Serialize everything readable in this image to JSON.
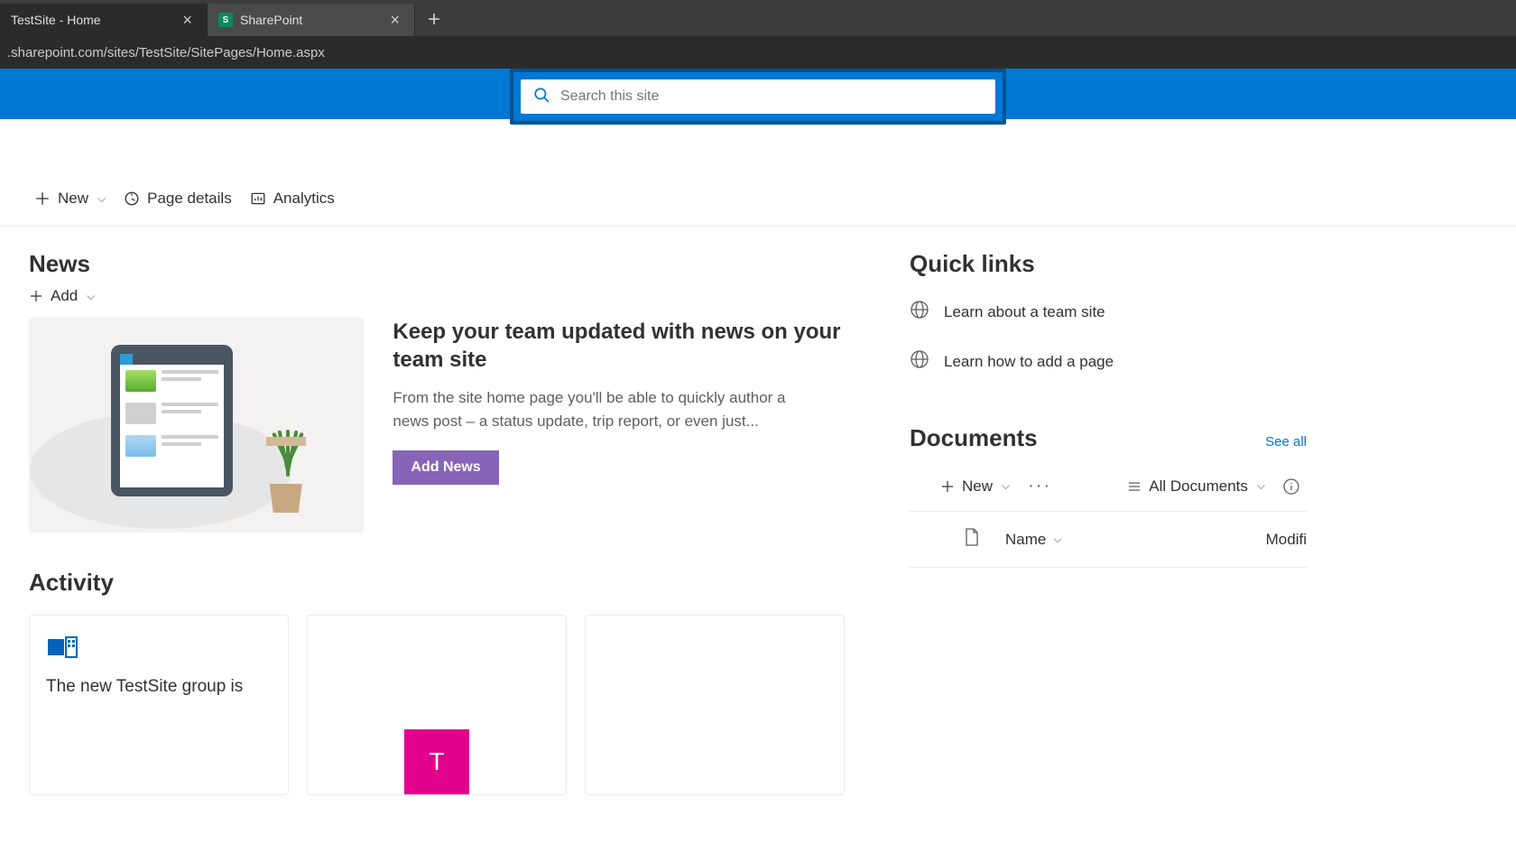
{
  "browser": {
    "tabs": [
      {
        "title": "TestSite - Home",
        "active": true
      },
      {
        "title": "SharePoint",
        "active": false,
        "favicon_letter": "S"
      }
    ],
    "url": ".sharepoint.com/sites/TestSite/SitePages/Home.aspx"
  },
  "search": {
    "placeholder": "Search this site"
  },
  "command_bar": {
    "new_label": "New",
    "page_details_label": "Page details",
    "analytics_label": "Analytics"
  },
  "news": {
    "title": "News",
    "add_label": "Add",
    "headline": "Keep your team updated with news on your team site",
    "body": "From the site home page you'll be able to quickly author a news post – a status update, trip report, or even just...",
    "add_news_button": "Add News"
  },
  "activity": {
    "title": "Activity",
    "card1_text": "The new TestSite group is",
    "card2_letter": "T"
  },
  "quick_links": {
    "title": "Quick links",
    "items": [
      {
        "label": "Learn about a team site"
      },
      {
        "label": "Learn how to add a page"
      }
    ]
  },
  "documents": {
    "title": "Documents",
    "see_all": "See all",
    "new_label": "New",
    "view_label": "All Documents",
    "columns": {
      "name": "Name",
      "modified": "Modifi"
    }
  }
}
